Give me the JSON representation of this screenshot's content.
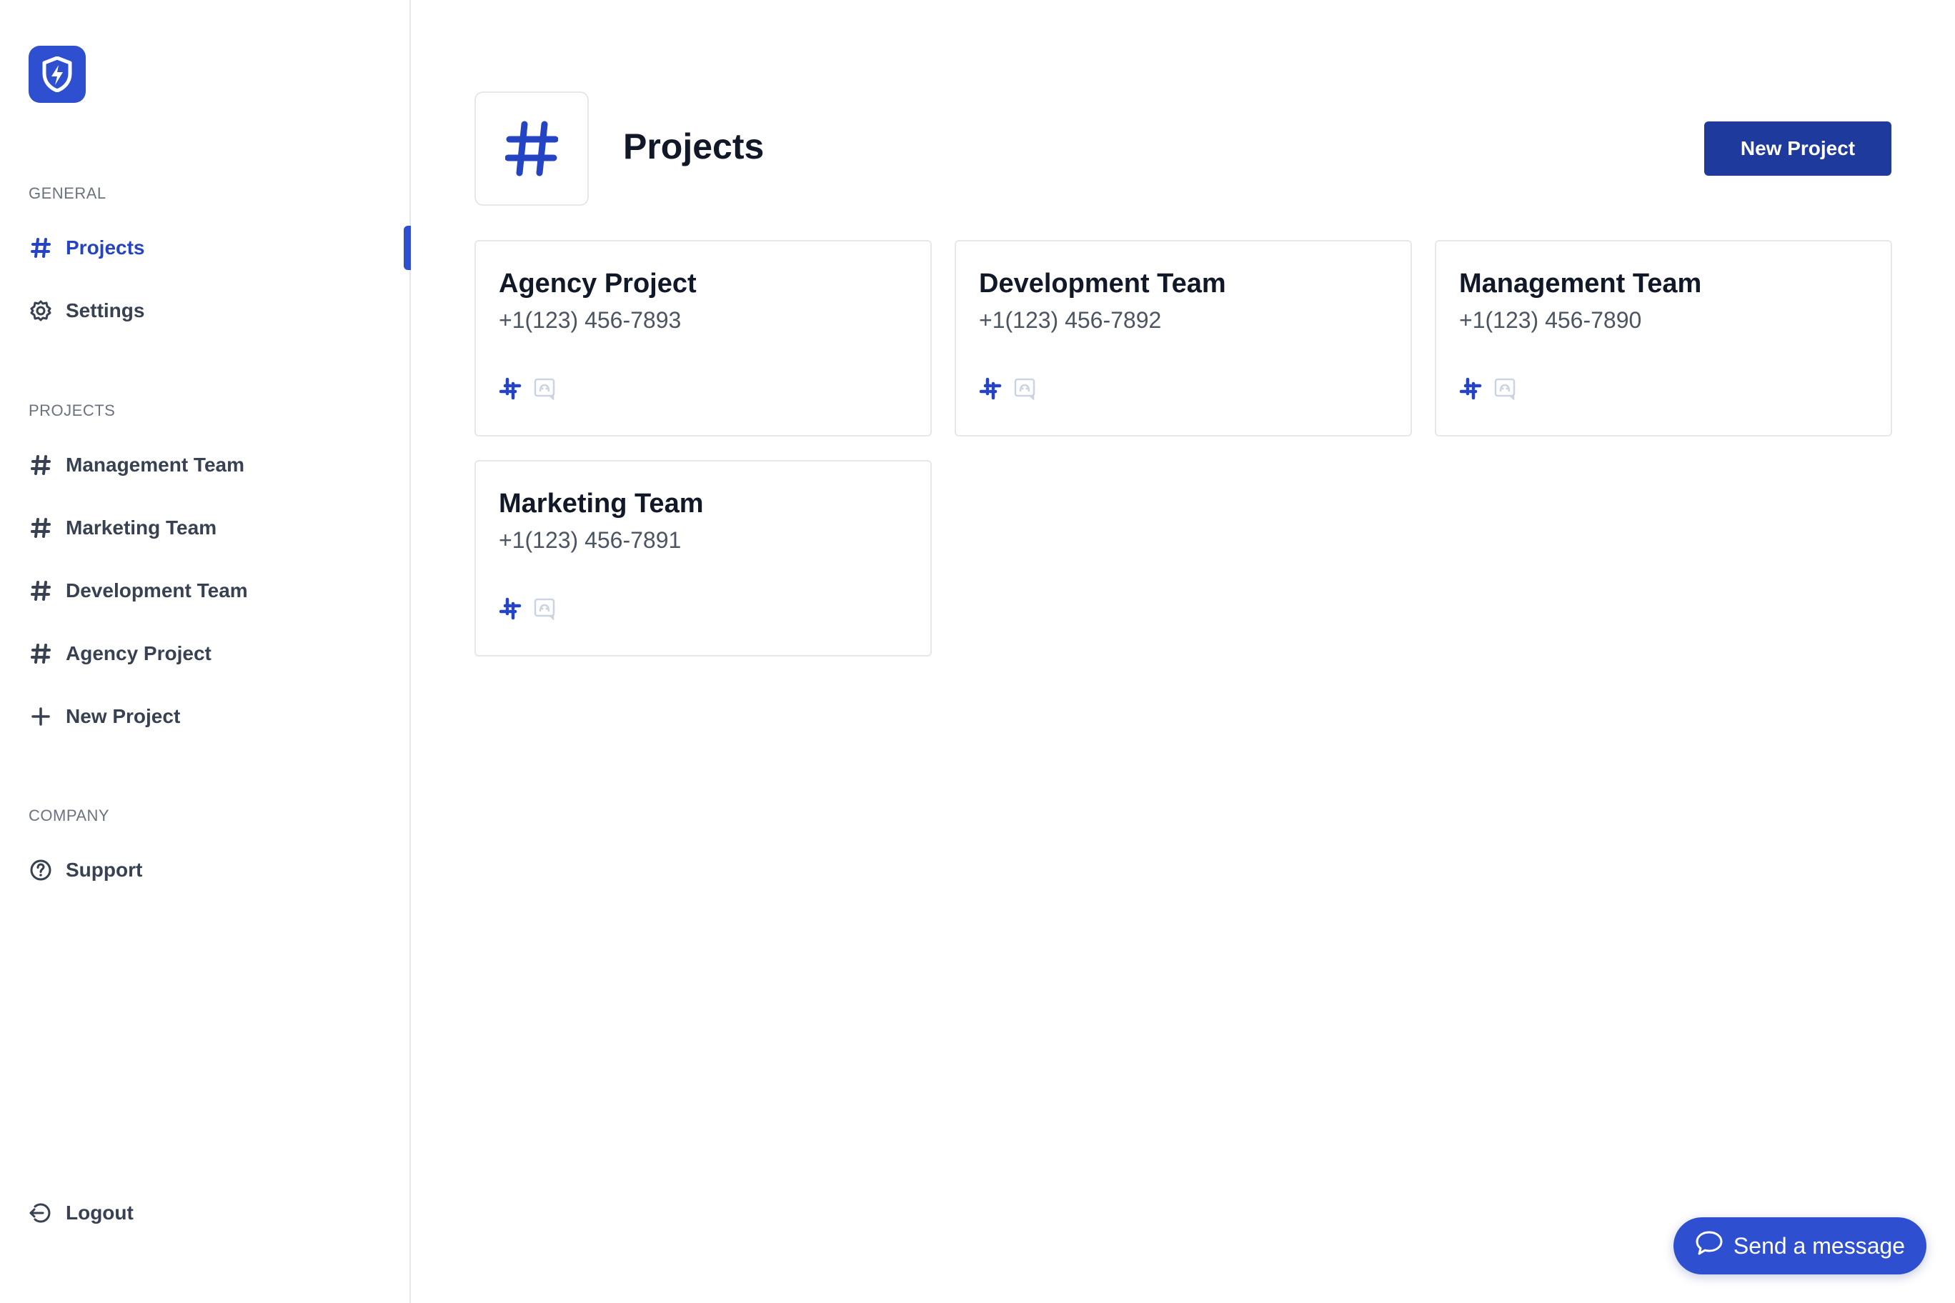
{
  "colors": {
    "accent": "#2e4fd0",
    "button": "#1f3a9d",
    "text": "#111827",
    "muted": "#6b7280"
  },
  "sidebar": {
    "logo_icon": "shield-bolt-icon",
    "sections": {
      "general": "GENERAL",
      "projects": "PROJECTS",
      "company": "COMPANY"
    },
    "general_items": [
      {
        "label": "Projects",
        "icon": "hash-icon",
        "active": true
      },
      {
        "label": "Settings",
        "icon": "gear-icon",
        "active": false
      }
    ],
    "project_items": [
      {
        "label": "Management Team",
        "icon": "hash-icon"
      },
      {
        "label": "Marketing Team",
        "icon": "hash-icon"
      },
      {
        "label": "Development Team",
        "icon": "hash-icon"
      },
      {
        "label": "Agency Project",
        "icon": "hash-icon"
      },
      {
        "label": "New Project",
        "icon": "plus-icon"
      }
    ],
    "company_items": [
      {
        "label": "Support",
        "icon": "help-circle-icon"
      }
    ],
    "logout": {
      "label": "Logout",
      "icon": "logout-icon"
    }
  },
  "main": {
    "title": "Projects",
    "header_icon": "hash-icon",
    "new_project_label": "New Project",
    "cards": [
      {
        "title": "Agency Project",
        "phone": "+1(123) 456-7893"
      },
      {
        "title": "Development Team",
        "phone": "+1(123) 456-7892"
      },
      {
        "title": "Management Team",
        "phone": "+1(123) 456-7890"
      },
      {
        "title": "Marketing Team",
        "phone": "+1(123) 456-7891"
      }
    ]
  },
  "chat": {
    "label": "Send a message",
    "icon": "chat-bubble-icon"
  }
}
